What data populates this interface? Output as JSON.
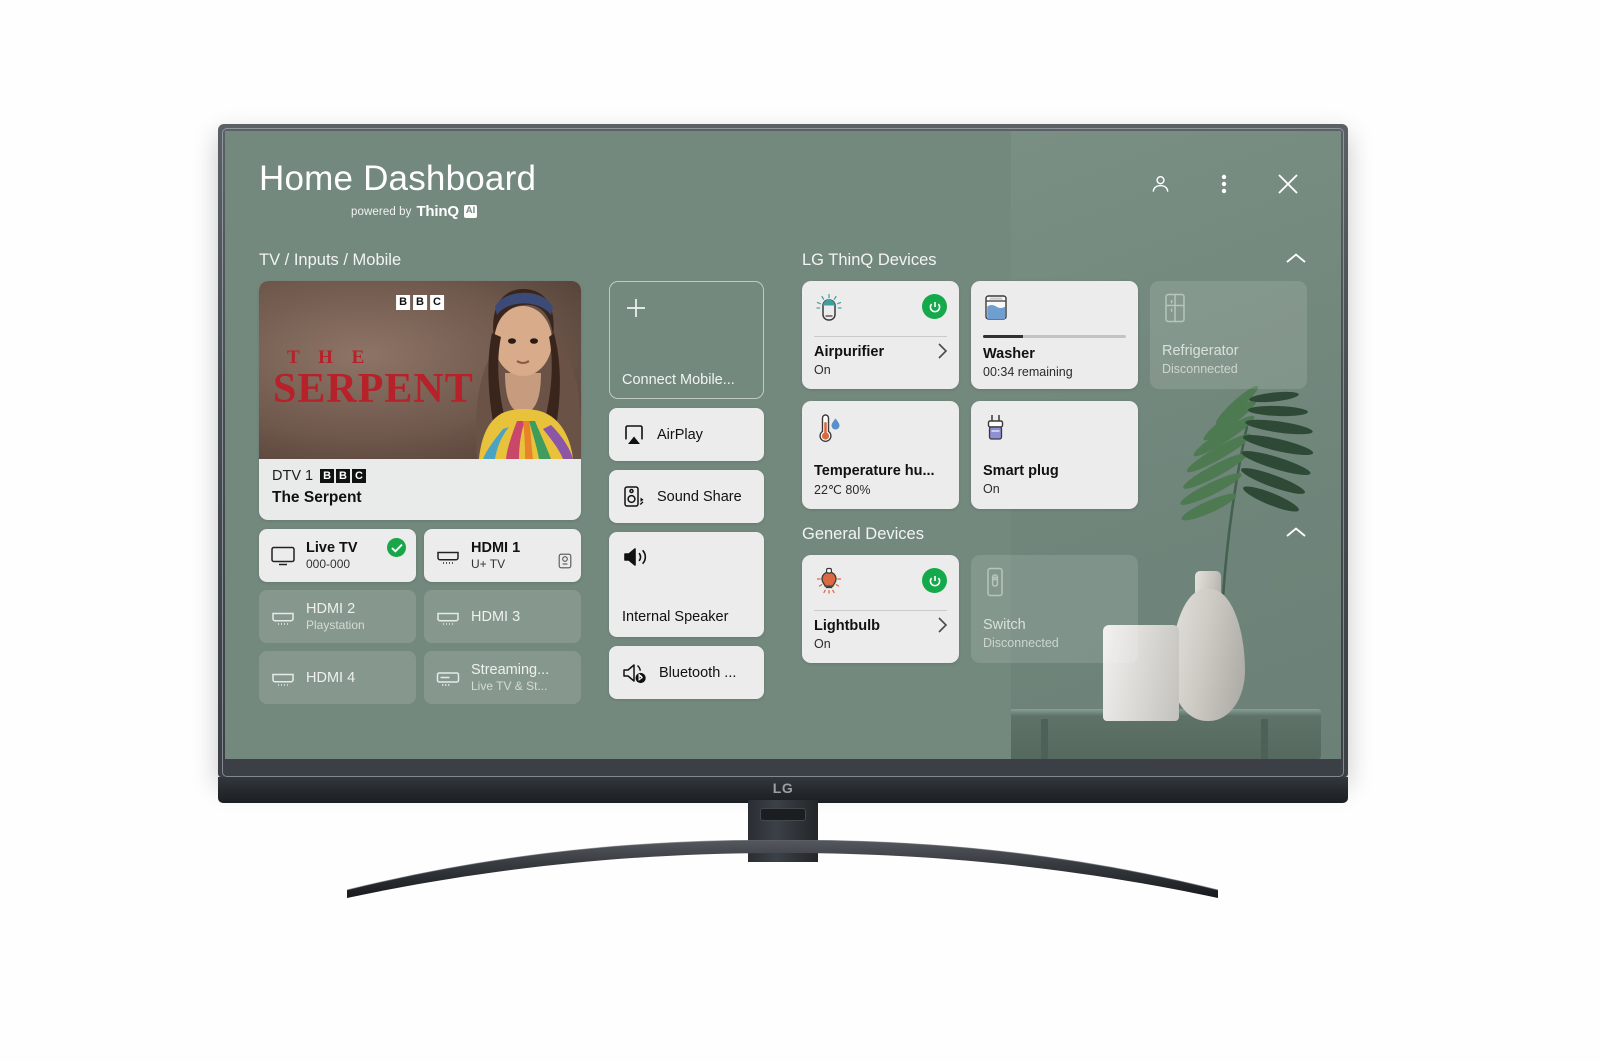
{
  "header": {
    "title": "Home Dashboard",
    "powered_by": "powered by",
    "brand": "ThinQ",
    "brand_badge": "AI",
    "icons": {
      "account": "account-icon",
      "more": "more-options-icon",
      "close": "close-icon"
    }
  },
  "left": {
    "section_label": "TV / Inputs / Mobile",
    "program": {
      "thumb_logo": [
        "B",
        "B",
        "C"
      ],
      "title_line1": "T H E",
      "title_line2": "SERPENT",
      "channel": "DTV 1",
      "channel_logo": [
        "B",
        "B",
        "C"
      ],
      "program_name": "The Serpent"
    },
    "inputs": [
      {
        "name": "Live TV",
        "sub": "000-000",
        "icon": "tv-icon",
        "active": true,
        "checked": true
      },
      {
        "name": "HDMI 1",
        "sub": "U+ TV",
        "icon": "hdmi-icon",
        "active": true,
        "corner_icon": "settop-box-icon"
      },
      {
        "name": "HDMI 2",
        "sub": "Playstation",
        "icon": "hdmi-icon",
        "active": false
      },
      {
        "name": "HDMI 3",
        "sub": "",
        "icon": "hdmi-icon",
        "active": false
      },
      {
        "name": "HDMI 4",
        "sub": "",
        "icon": "hdmi-icon",
        "active": false
      },
      {
        "name": "Streaming...",
        "sub": "Live TV & St...",
        "icon": "streaming-box-icon",
        "active": false
      }
    ]
  },
  "middle": {
    "connect_mobile": {
      "label": "Connect Mobile...",
      "icon": "plus-icon"
    },
    "buttons": [
      {
        "label": "AirPlay",
        "icon": "airplay-icon",
        "tall": false
      },
      {
        "label": "Sound Share",
        "icon": "sound-share-icon",
        "tall": false
      },
      {
        "label": "Internal Speaker",
        "icon": "speaker-icon",
        "tall": true
      },
      {
        "label": "Bluetooth ...",
        "icon": "bluetooth-speaker-icon",
        "tall": false
      }
    ]
  },
  "right": {
    "thinq": {
      "section_label": "LG ThinQ Devices",
      "collapse_icon": "chevron-up-icon",
      "devices": [
        {
          "name": "Airpurifier",
          "status": "On",
          "icon": "air-purifier-icon",
          "power": true,
          "chevron": true,
          "divider": true,
          "disabled": false
        },
        {
          "name": "Washer",
          "status": "00:34 remaining",
          "icon": "washer-icon",
          "progress": 28,
          "disabled": false
        },
        {
          "name": "Refrigerator",
          "status": "Disconnected",
          "icon": "refrigerator-icon",
          "disabled": true
        },
        {
          "name": "Temperature hu...",
          "status": "22℃ 80%",
          "icon": "thermometer-humidity-icon",
          "disabled": false
        },
        {
          "name": "Smart plug",
          "status": "On",
          "icon": "smart-plug-icon",
          "disabled": false
        }
      ]
    },
    "general": {
      "section_label": "General Devices",
      "collapse_icon": "chevron-up-icon",
      "devices": [
        {
          "name": "Lightbulb",
          "status": "On",
          "icon": "lightbulb-icon",
          "power": true,
          "chevron": true,
          "divider": true,
          "disabled": false
        },
        {
          "name": "Switch",
          "status": "Disconnected",
          "icon": "wall-switch-icon",
          "disabled": true
        }
      ]
    }
  },
  "tv": {
    "brand_logo": "LG"
  },
  "colors": {
    "screen_background": "#74897d",
    "card_background": "#ececec",
    "accent_green": "#14a94a",
    "bezel": "#474c52"
  }
}
